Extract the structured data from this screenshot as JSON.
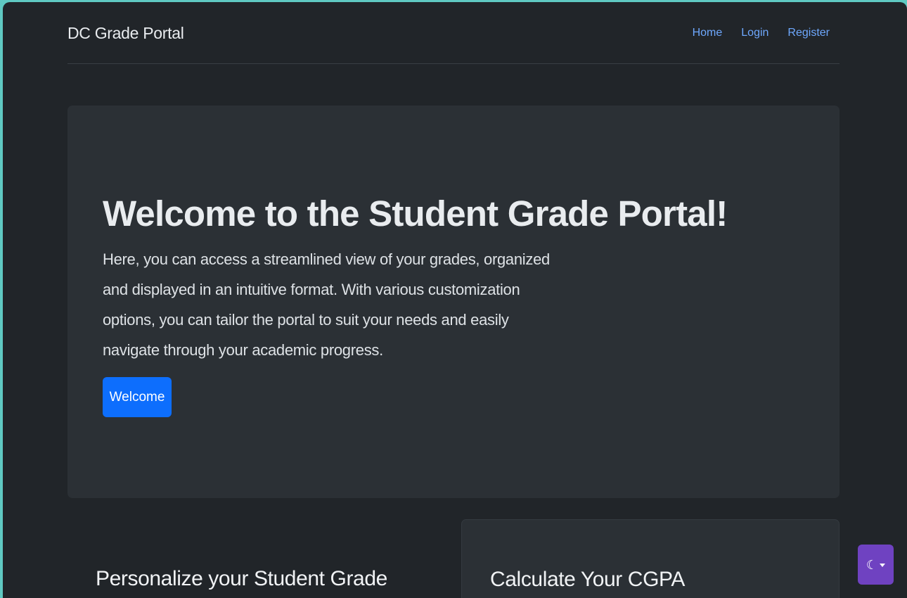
{
  "navbar": {
    "brand": "DC Grade Portal",
    "links": [
      {
        "label": "Home"
      },
      {
        "label": "Login"
      },
      {
        "label": "Register"
      }
    ]
  },
  "hero": {
    "title": "Welcome to the Student Grade Portal!",
    "description": "Here, you can access a streamlined view of your grades, organized and displayed in an intuitive format. With various customization options, you can tailor the portal to suit your needs and easily navigate through your academic progress.",
    "button_label": "Welcome"
  },
  "sections": {
    "left_heading": "Personalize your Student Grade",
    "right_heading": "Calculate Your CGPA"
  },
  "theme_toggle": {
    "icon": "moon-icon",
    "color": "#6f42c1"
  },
  "colors": {
    "background": "#212529",
    "card": "#2b3035",
    "primary": "#0d6efd",
    "link": "#6ea8fe"
  }
}
